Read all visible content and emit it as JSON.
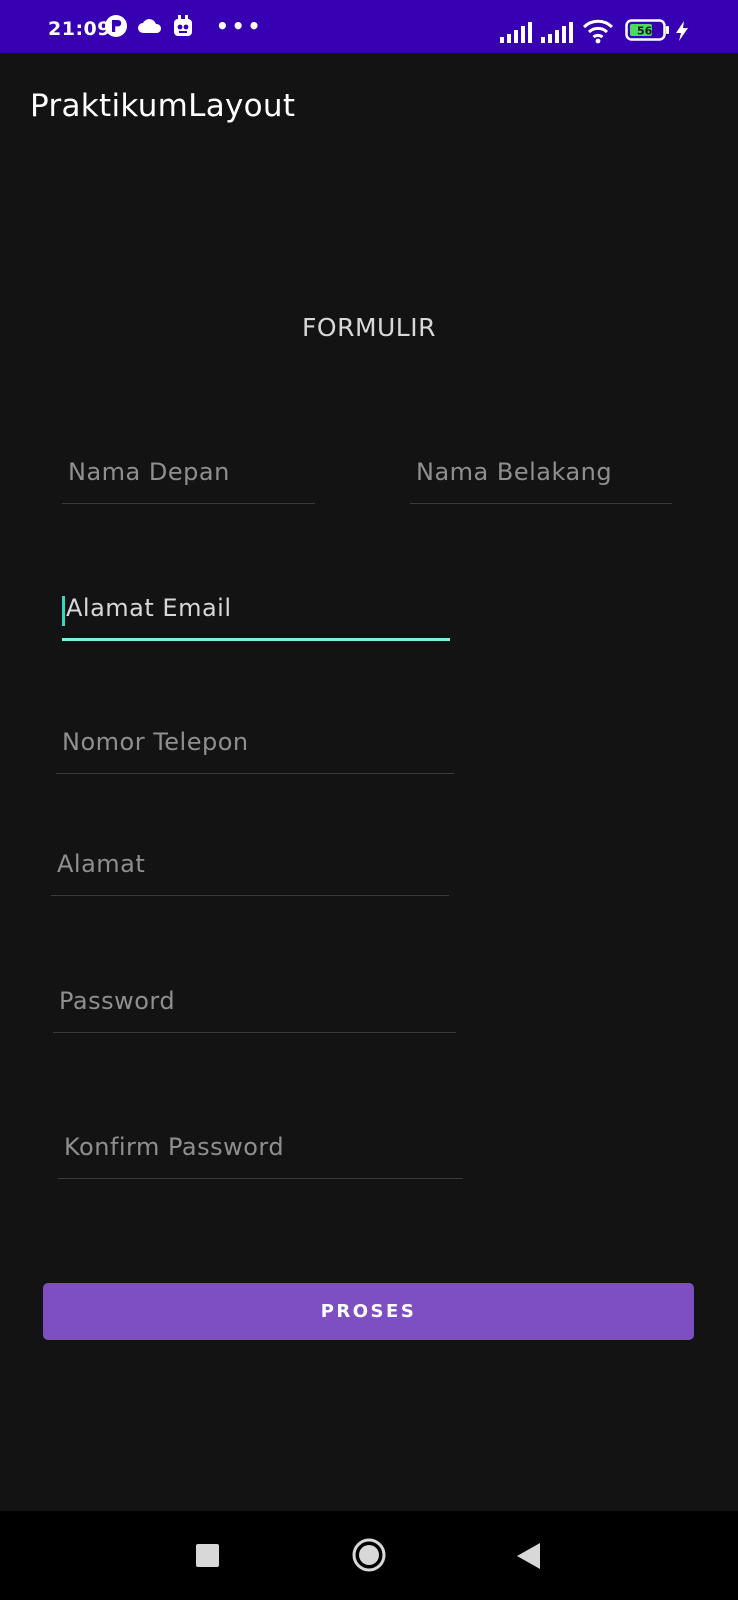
{
  "status_bar": {
    "time": "21:09",
    "more_indicator": "•••",
    "battery_level": "56",
    "icons": [
      "p-badge-icon",
      "cloud-icon",
      "notification-app-icon",
      "signal-icon",
      "signal-icon",
      "wifi-icon",
      "battery-icon",
      "charging-bolt-icon"
    ]
  },
  "app_bar": {
    "title": "PraktikumLayout"
  },
  "form": {
    "title": "FORMULIR",
    "fields": {
      "first_name": {
        "placeholder": "Nama Depan",
        "value": ""
      },
      "last_name": {
        "placeholder": "Nama Belakang",
        "value": ""
      },
      "email": {
        "placeholder": "Alamat Email",
        "value": ""
      },
      "phone": {
        "placeholder": "Nomor Telepon",
        "value": ""
      },
      "address": {
        "placeholder": "Alamat",
        "value": ""
      },
      "password": {
        "placeholder": "Password",
        "value": ""
      },
      "confirm_password": {
        "placeholder": "Konfirm Password",
        "value": ""
      }
    },
    "submit_label": "PROSES"
  },
  "nav_bar": {
    "icons": [
      "recents-square-icon",
      "home-circle-icon",
      "back-triangle-icon"
    ]
  },
  "colors": {
    "status_bar": "#3700b3",
    "background": "#131313",
    "accent_button": "#7e4fc0",
    "focus_underline": "#7ef2e0"
  }
}
